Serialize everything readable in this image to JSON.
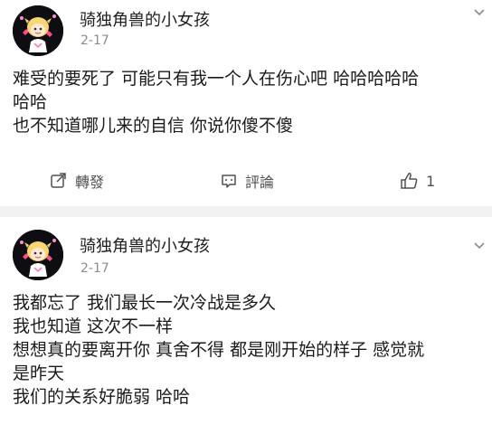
{
  "posts": [
    {
      "username": "骑独角兽的小女孩",
      "date": "2-17",
      "lines": [
        "难受的要死了 可能只有我一个人在伤心吧 哈哈哈哈哈",
        "哈哈",
        "也不知道哪儿来的自信 你说你傻不傻"
      ],
      "actions": {
        "repost_label": "轉發",
        "comment_label": "評論",
        "like_count": "1"
      }
    },
    {
      "username": "骑独角兽的小女孩",
      "date": "2-17",
      "lines": [
        "我都忘了 我们最长一次冷战是多久",
        "我也知道 这次不一样",
        "想想真的要离开你 真舍不得 都是刚开始的样子 感觉就",
        "是昨天",
        "我们的关系好脆弱  哈哈"
      ]
    }
  ],
  "icons": {
    "avatar": "cartoon-girl-avatar",
    "menu": "chevron-down-icon",
    "repost": "repost-icon",
    "comment": "comment-icon",
    "like": "thumbs-up-icon"
  }
}
